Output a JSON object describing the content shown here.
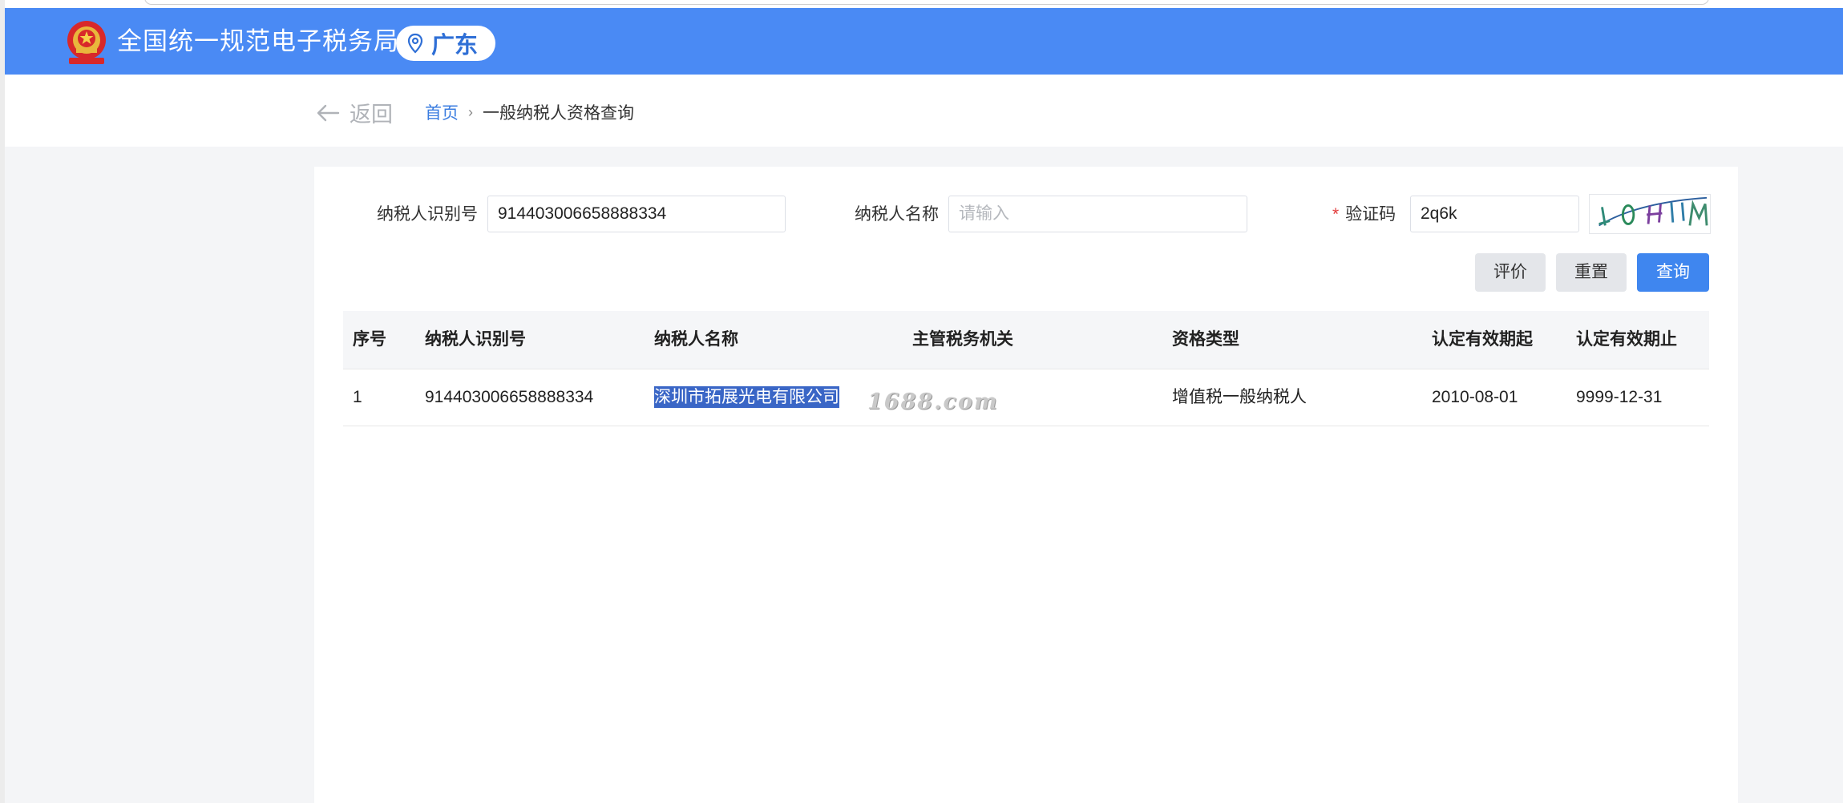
{
  "header": {
    "site_title": "全国统一规范电子税务局",
    "region": "广东",
    "brand_color": "#4a8af4"
  },
  "breadcrumb": {
    "back_label": "返回",
    "home": "首页",
    "separator": "›",
    "current": "一般纳税人资格查询"
  },
  "form": {
    "taxpayer_id_label": "纳税人识别号",
    "taxpayer_id_value": "914403006658888334",
    "taxpayer_name_label": "纳税人名称",
    "taxpayer_name_placeholder": "请输入",
    "captcha_required_mark": "*",
    "captcha_label": "验证码",
    "captcha_value": "2q6k"
  },
  "buttons": {
    "evaluate": "评价",
    "reset": "重置",
    "query": "查询"
  },
  "table": {
    "columns": [
      "序号",
      "纳税人识别号",
      "纳税人名称",
      "主管税务机关",
      "资格类型",
      "认定有效期起",
      "认定有效期止"
    ],
    "rows": [
      [
        "1",
        "914403006658888334",
        "深圳市拓展光电有限公司",
        "",
        "增值税一般纳税人",
        "2010-08-01",
        "9999-12-31"
      ]
    ]
  },
  "watermark": "1688.com"
}
